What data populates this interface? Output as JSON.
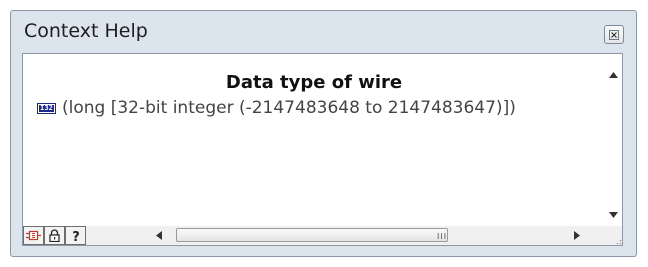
{
  "window": {
    "title": "Context Help"
  },
  "help": {
    "heading": "Data type of wire",
    "type_icon_label": "I32",
    "description": "(long [32-bit integer (-2147483648 to 2147483647)])"
  },
  "toolbar": {
    "buttons": [
      "show-optional-terminals-icon",
      "lock-icon",
      "detailed-help-icon"
    ]
  },
  "horizontal_scrollbar": {
    "grip": "III"
  }
}
